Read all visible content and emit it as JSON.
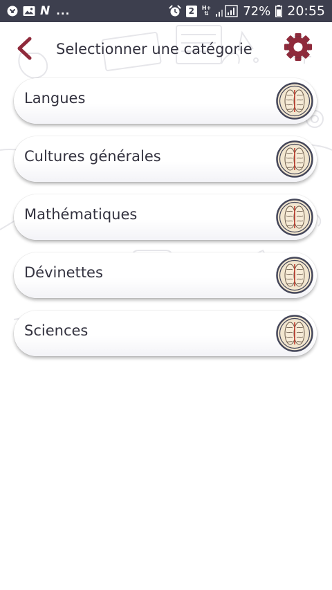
{
  "status_bar": {
    "left_icons": [
      "settings-notification-icon",
      "image-notification-icon",
      "n-app-icon"
    ],
    "more": "...",
    "alarm_icon": "alarm-clock-icon",
    "sim_badge": "2",
    "network": "H+",
    "battery_percent": "72%",
    "time": "20:55"
  },
  "header": {
    "back_icon": "chevron-left-icon",
    "title": "Selectionner une catégorie",
    "settings_icon": "gear-icon"
  },
  "categories": [
    {
      "label": "Langues",
      "icon": "brain-icon"
    },
    {
      "label": "Cultures générales",
      "icon": "brain-icon"
    },
    {
      "label": "Mathématiques",
      "icon": "brain-icon"
    },
    {
      "label": "Dévinettes",
      "icon": "brain-icon"
    },
    {
      "label": "Sciences",
      "icon": "brain-icon"
    }
  ],
  "colors": {
    "status_bar": "#3d3f4e",
    "accent": "#8f2a3b",
    "text": "#33323f",
    "icon_ring": "#45475a",
    "icon_fill": "#f2e6cf"
  }
}
